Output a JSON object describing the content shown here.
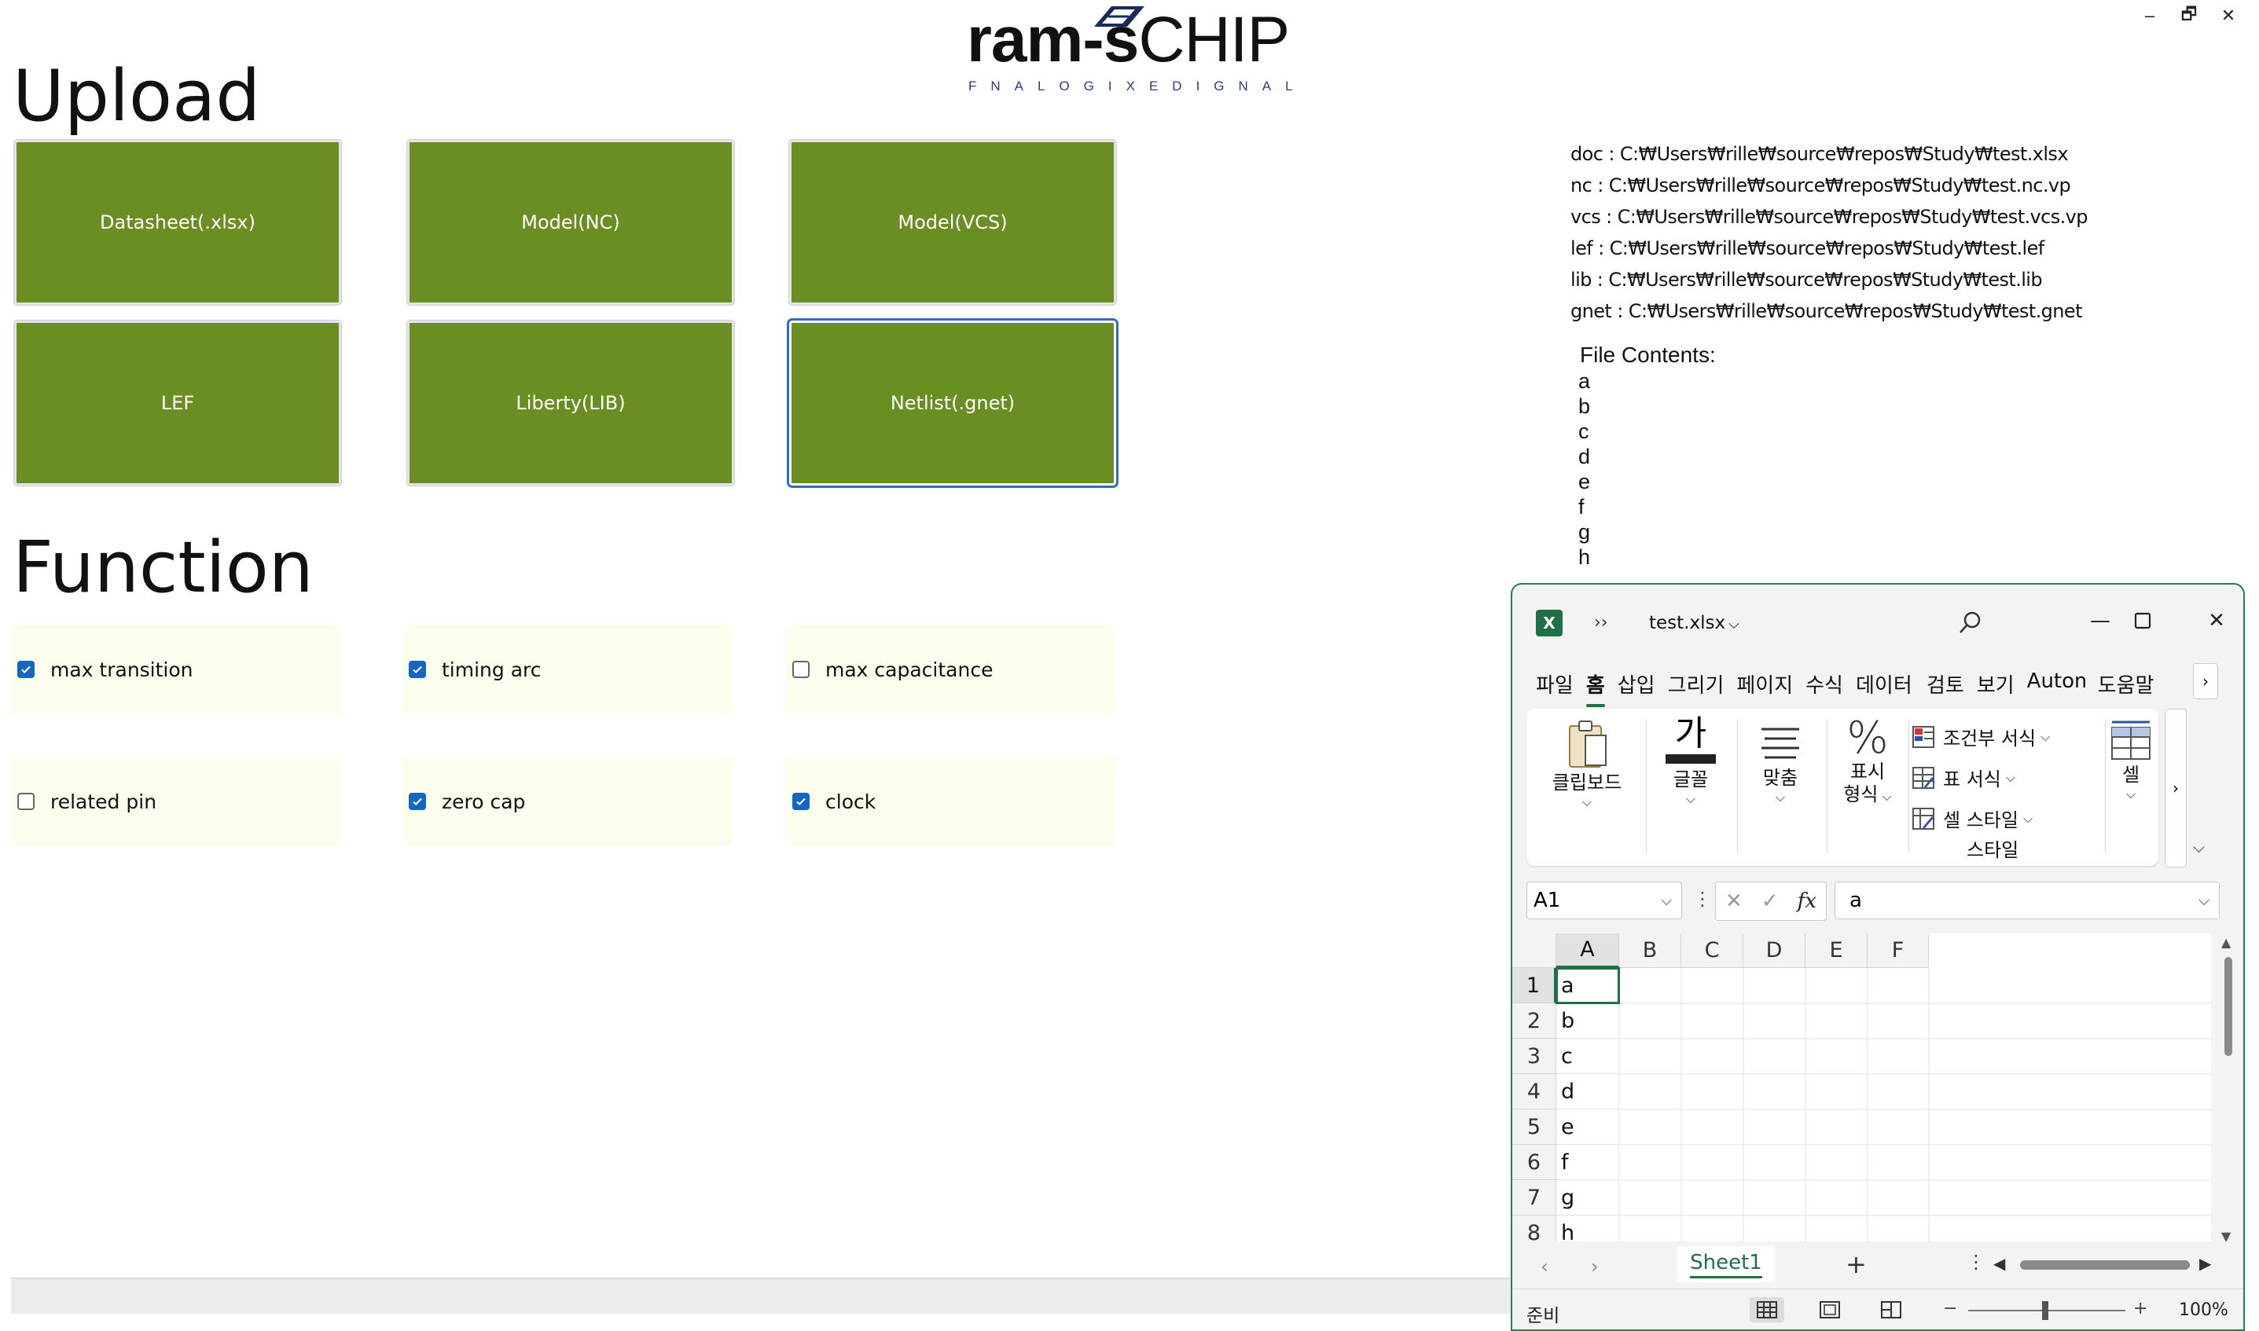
{
  "logo": {
    "brand_bold": "ram-s",
    "brand_rest": "CHIP",
    "tagline": "FNALOGIXEDIGNAL"
  },
  "window_controls": {
    "minimize": "–",
    "restore": "🗗",
    "close": "✕"
  },
  "upload": {
    "title": "Upload",
    "buttons": [
      {
        "label": "Datasheet(.xlsx)"
      },
      {
        "label": "Model(NC)"
      },
      {
        "label": "Model(VCS)"
      },
      {
        "label": "LEF"
      },
      {
        "label": "Liberty(LIB)"
      },
      {
        "label": "Netlist(.gnet)"
      }
    ]
  },
  "function": {
    "title": "Function",
    "items": [
      {
        "label": "max transition",
        "checked": true
      },
      {
        "label": "timing arc",
        "checked": true
      },
      {
        "label": "max capacitance",
        "checked": false
      },
      {
        "label": "related pin",
        "checked": false
      },
      {
        "label": "zero cap",
        "checked": true
      },
      {
        "label": "clock",
        "checked": true
      }
    ]
  },
  "paths": [
    "doc : C:₩Users₩rille₩source₩repos₩Study₩test.xlsx",
    "nc : C:₩Users₩rille₩source₩repos₩Study₩test.nc.vp",
    "vcs : C:₩Users₩rille₩source₩repos₩Study₩test.vcs.vp",
    "lef : C:₩Users₩rille₩source₩repos₩Study₩test.lef",
    "lib : C:₩Users₩rille₩source₩repos₩Study₩test.lib",
    "gnet : C:₩Users₩rille₩source₩repos₩Study₩test.gnet"
  ],
  "file_contents": {
    "title": "File Contents:",
    "lines": [
      "a",
      "b",
      "c",
      "d",
      "e",
      "f",
      "g",
      "h"
    ]
  },
  "excel": {
    "app_icon": "X",
    "more": "››",
    "file_name": "test.xlsx",
    "tabs": [
      "파일",
      "홈",
      "삽입",
      "그리기",
      "페이지",
      "수식",
      "데이터",
      "검토",
      "보기",
      "Automate",
      "도움말"
    ],
    "active_tab": "홈",
    "ribbon": {
      "clipboard": "클립보드",
      "font": "글꼴",
      "align": "맞춤",
      "number_line1": "표시",
      "number_line2": "형식",
      "conditional": "조건부 서식",
      "table_format": "표 서식",
      "cell_style": "셀 스타일",
      "styles_group": "스타일",
      "cells": "셀",
      "font_glyph": "가",
      "percent_glyph": "%"
    },
    "name_box": "A1",
    "formula_value": "a",
    "fx": "fx",
    "columns": [
      "A",
      "B",
      "C",
      "D",
      "E",
      "F"
    ],
    "rows": [
      "1",
      "2",
      "3",
      "4",
      "5",
      "6",
      "7",
      "8"
    ],
    "column_a": [
      "a",
      "b",
      "c",
      "d",
      "e",
      "f",
      "g",
      "h"
    ],
    "sheet_name": "Sheet1",
    "add_sheet": "+",
    "status_ready": "준비",
    "zoom_pct": "100%"
  }
}
